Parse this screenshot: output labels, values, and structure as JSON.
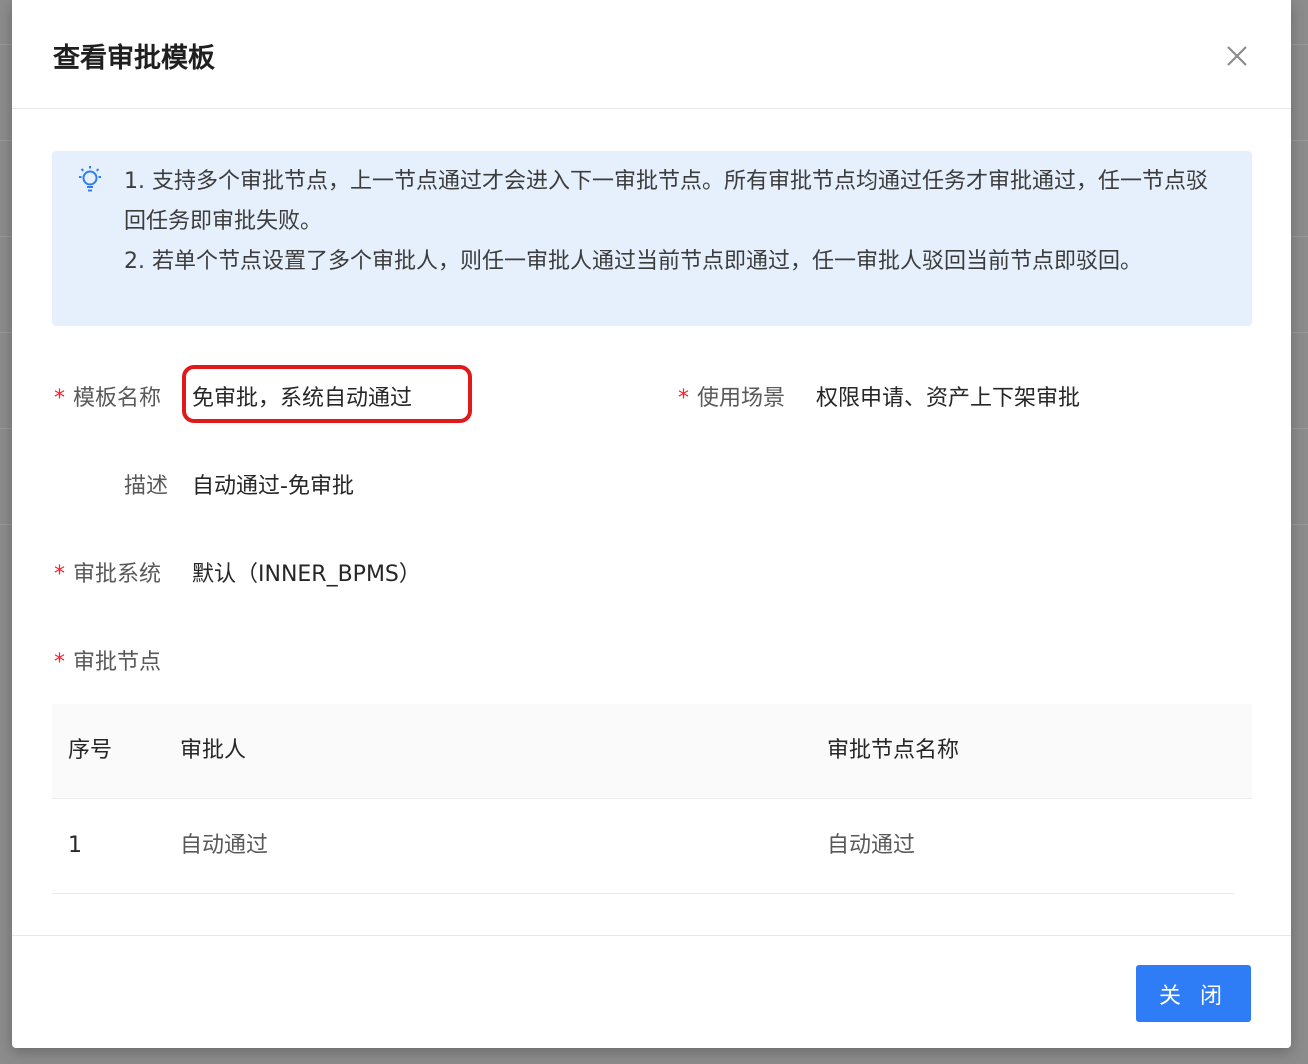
{
  "modal": {
    "title": "查看审批模板",
    "close_icon": "close-icon"
  },
  "notice": {
    "icon": "lightbulb-icon",
    "lines": [
      "1. 支持多个审批节点，上一节点通过才会进入下一审批节点。所有审批节点均通过任务才审批通过，任一节点驳回任务即审批失败。",
      "2. 若单个节点设置了多个审批人，则任一审批人通过当前节点即通过，任一审批人驳回当前节点即驳回。"
    ]
  },
  "fields": {
    "required_mark": "*",
    "template_name": {
      "label": "模板名称",
      "value": "免审批，系统自动通过"
    },
    "scenario": {
      "label": "使用场景",
      "value": "权限申请、资产上下架审批"
    },
    "description": {
      "label": "描述",
      "value": "自动通过-免审批"
    },
    "approval_system": {
      "label": "审批系统",
      "value": "默认（INNER_BPMS）"
    },
    "approval_nodes": {
      "label": "审批节点"
    }
  },
  "table": {
    "headers": [
      "序号",
      "审批人",
      "审批节点名称"
    ],
    "rows": [
      [
        "1",
        "自动通过",
        "自动通过"
      ]
    ]
  },
  "footer": {
    "close_label": "关 闭"
  },
  "colors": {
    "primary": "#2f7df6",
    "required": "#f5222d",
    "highlight": "#e0191b",
    "notice_bg": "#e6f0fd"
  }
}
